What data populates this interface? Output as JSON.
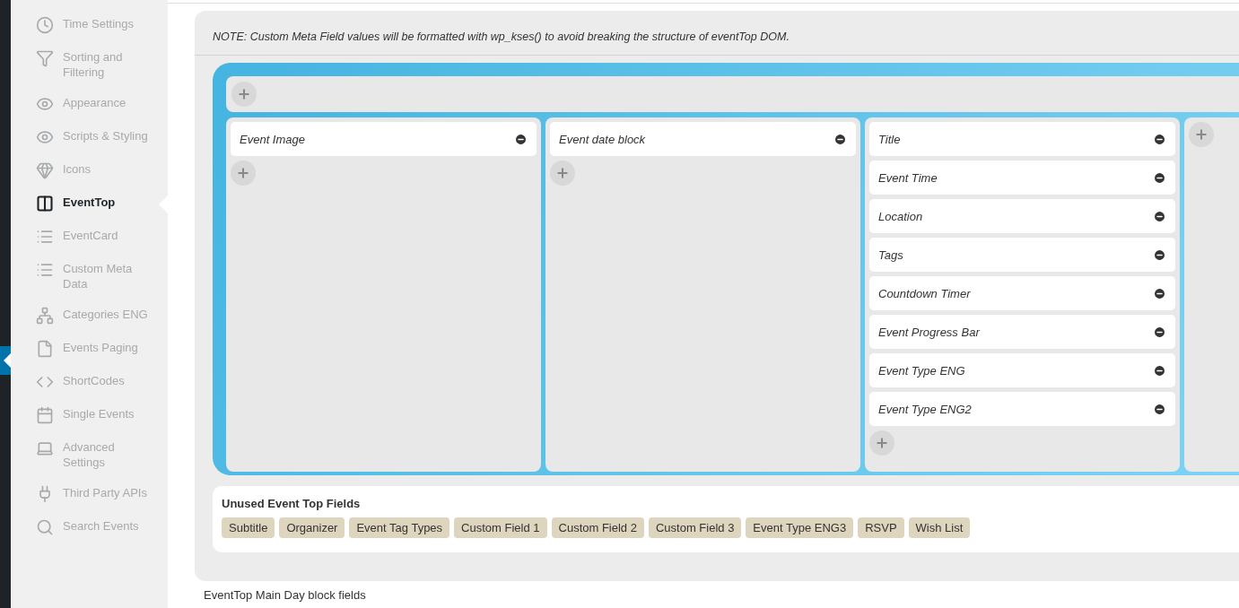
{
  "sidebar": {
    "items": [
      {
        "label": "Time Settings",
        "selected": false
      },
      {
        "label": "Sorting and Filtering",
        "selected": false
      },
      {
        "label": "Appearance",
        "selected": false
      },
      {
        "label": "Scripts & Styling",
        "selected": false
      },
      {
        "label": "Icons",
        "selected": false
      },
      {
        "label": "EventTop",
        "selected": true
      },
      {
        "label": "EventCard",
        "selected": false
      },
      {
        "label": "Custom Meta Data",
        "selected": false
      },
      {
        "label": "Categories ENG",
        "selected": false
      },
      {
        "label": "Events Paging",
        "selected": false
      },
      {
        "label": "ShortCodes",
        "selected": false
      },
      {
        "label": "Single Events",
        "selected": false
      },
      {
        "label": "Advanced Settings",
        "selected": false
      },
      {
        "label": "Third Party APIs",
        "selected": false
      },
      {
        "label": "Search Events",
        "selected": false
      }
    ]
  },
  "note": "NOTE: Custom Meta Field values will be formatted with wp_kses() to avoid breaking the structure of eventTop DOM.",
  "layout": {
    "columns": [
      {
        "fields": [
          "Event Image"
        ]
      },
      {
        "fields": [
          "Event date block"
        ]
      },
      {
        "fields": [
          "Title",
          "Event Time",
          "Location",
          "Tags",
          "Countdown Timer",
          "Event Progress Bar",
          "Event Type ENG",
          "Event Type ENG2"
        ]
      },
      {}
    ]
  },
  "unused": {
    "title": "Unused Event Top Fields",
    "fields": [
      "Subtitle",
      "Organizer",
      "Event Tag Types",
      "Custom Field 1",
      "Custom Field 2",
      "Custom Field 3",
      "Event Type ENG3",
      "RSVP",
      "Wish List"
    ]
  },
  "next_section_title": "EventTop Main Day block fields"
}
